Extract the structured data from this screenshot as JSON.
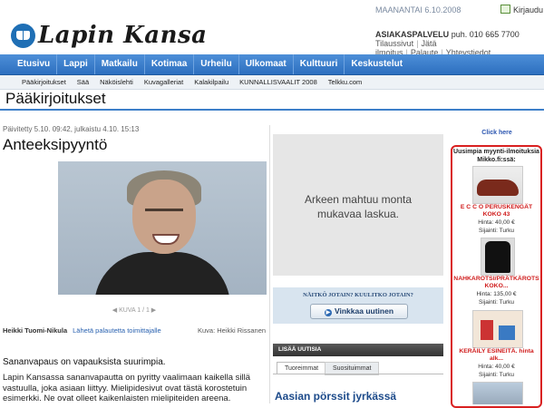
{
  "header": {
    "date": "MAANANTAI 6.10.2008",
    "print_label": "Kirjaudu",
    "logo_text": "Lapin Kansa",
    "customer_service_label": "ASIAKASPALVELU",
    "customer_service_phone": "puh. 010 665 7700",
    "service_links": [
      "Tilaussivut",
      "Jätä ilmoitus",
      "Palaute",
      "Yhteystiedot"
    ]
  },
  "nav": {
    "items": [
      "Etusivu",
      "Lappi",
      "Matkailu",
      "Kotimaa",
      "Urheilu",
      "Ulkomaat",
      "Kulttuuri",
      "Keskustelut"
    ]
  },
  "subnav": {
    "items": [
      "Pääkirjoitukset",
      "Sää",
      "Näköislehti",
      "Kuvagalleriat",
      "Kalakilpailu",
      "KUNNALLISVAALIT 2008",
      "Telkku.com"
    ]
  },
  "section_title": "Pääkirjoitukset",
  "article": {
    "meta": "Päivitetty 5.10. 09:42, julkaistu 4.10. 15:13",
    "headline": "Anteeksipyyntö",
    "image_counter": "KUVA 1 / 1",
    "author": "Heikki Tuomi-Nikula",
    "feedback_link": "Lähetä palautetta toimittajalle",
    "photo_credit": "Kuva: Heikki Rissanen",
    "lead": "Sananvapaus on vapauksista suurimpia.",
    "body": "Lapin Kansassa sananvapautta on pyritty vaalimaan kaikella sillä vastuulla, joka asiaan liittyy. Mielipidesivut ovat tästä korostetuin esimerkki. Ne ovat olleet kaikenlaisten mielipiteiden areena."
  },
  "ad": {
    "text_line1": "Arkeen mahtuu monta",
    "text_line2": "mukavaa laskua.",
    "tip_question": "NÄITKÖ JOTAIN? KUULITKO JOTAIN?",
    "tip_button": "Vinkkaa uutinen"
  },
  "news": {
    "section_label": "LISÄÄ UUTISIA",
    "tabs": [
      "Tuoreimmat",
      "Suosituimmat"
    ],
    "first_headline": "Aasian pörssit jyrkässä"
  },
  "sidebar": {
    "click_here": "Click here",
    "market_title": "Uusimpia myynti-ilmoituksia Mikko.fi:ssä:",
    "items": [
      {
        "name": "E C C O PERUSKENGÄT KOKO 43",
        "price": "Hinta: 40,00 €",
        "location": "Sijainti: Turku"
      },
      {
        "name": "NAHKAROTSI/PRÄTKÄROTS KOKO...",
        "price": "Hinta: 135,00 €",
        "location": "Sijainti: Turku"
      },
      {
        "name": "KERÄILY ESINEITÄ. hinta alk...",
        "price": "Hinta: 40,00 €",
        "location": "Sijainti: Turku"
      }
    ]
  }
}
